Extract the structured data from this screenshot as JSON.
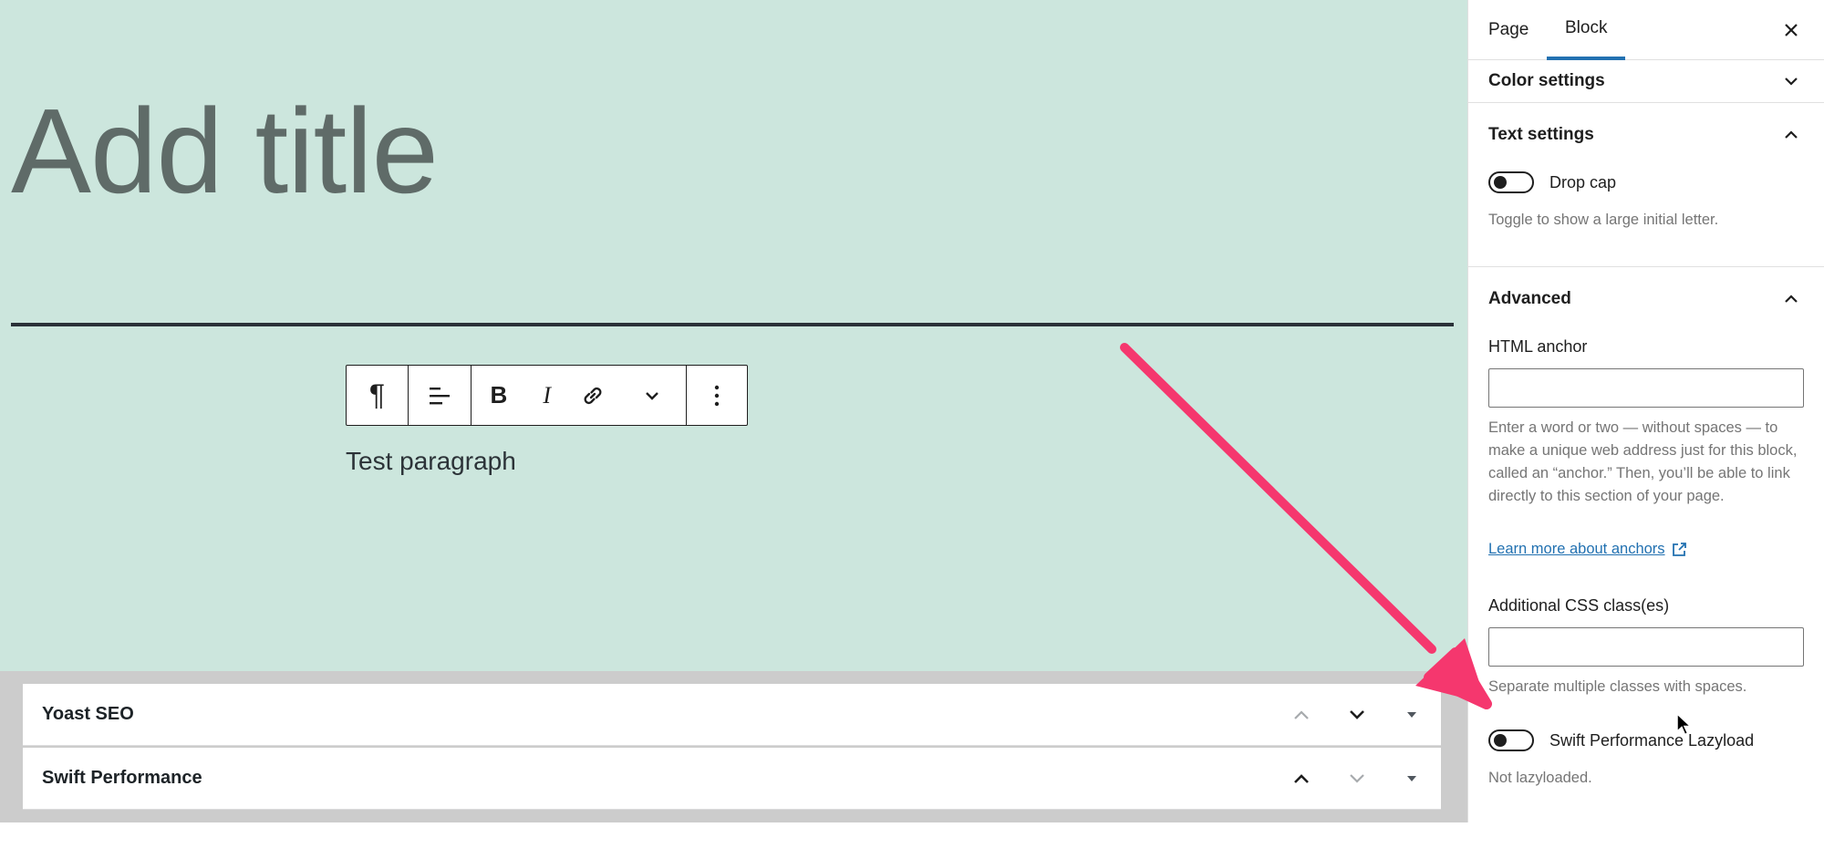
{
  "editor": {
    "title_placeholder": "Add title",
    "paragraph_text": "Test paragraph"
  },
  "toolbar": {
    "paragraph_icon": "¶",
    "bold_label": "B",
    "italic_label": "I"
  },
  "metaboxes": [
    {
      "title": "Yoast SEO"
    },
    {
      "title": "Swift Performance"
    }
  ],
  "sidebar": {
    "tabs": [
      {
        "label": "Page"
      },
      {
        "label": "Block",
        "active": true
      }
    ],
    "color_settings": {
      "title": "Color settings"
    },
    "text_settings": {
      "title": "Text settings",
      "drop_cap_label": "Drop cap",
      "drop_cap_help": "Toggle to show a large initial letter."
    },
    "advanced": {
      "title": "Advanced",
      "html_anchor_label": "HTML anchor",
      "html_anchor_value": "",
      "html_anchor_help": "Enter a word or two — without spaces — to make a unique web address just for this block, called an “anchor.” Then, you’ll be able to link directly to this section of your page.",
      "learn_more_link": "Learn more about anchors",
      "css_class_label": "Additional CSS class(es)",
      "css_class_value": "",
      "css_class_help": "Separate multiple classes with spaces.",
      "lazyload_label": "Swift Performance Lazyload",
      "lazyload_help": "Not lazyloaded."
    }
  },
  "colors": {
    "canvas_bg": "#cce6dd",
    "accent": "#2271b1",
    "annotation_arrow": "#f5376e"
  }
}
